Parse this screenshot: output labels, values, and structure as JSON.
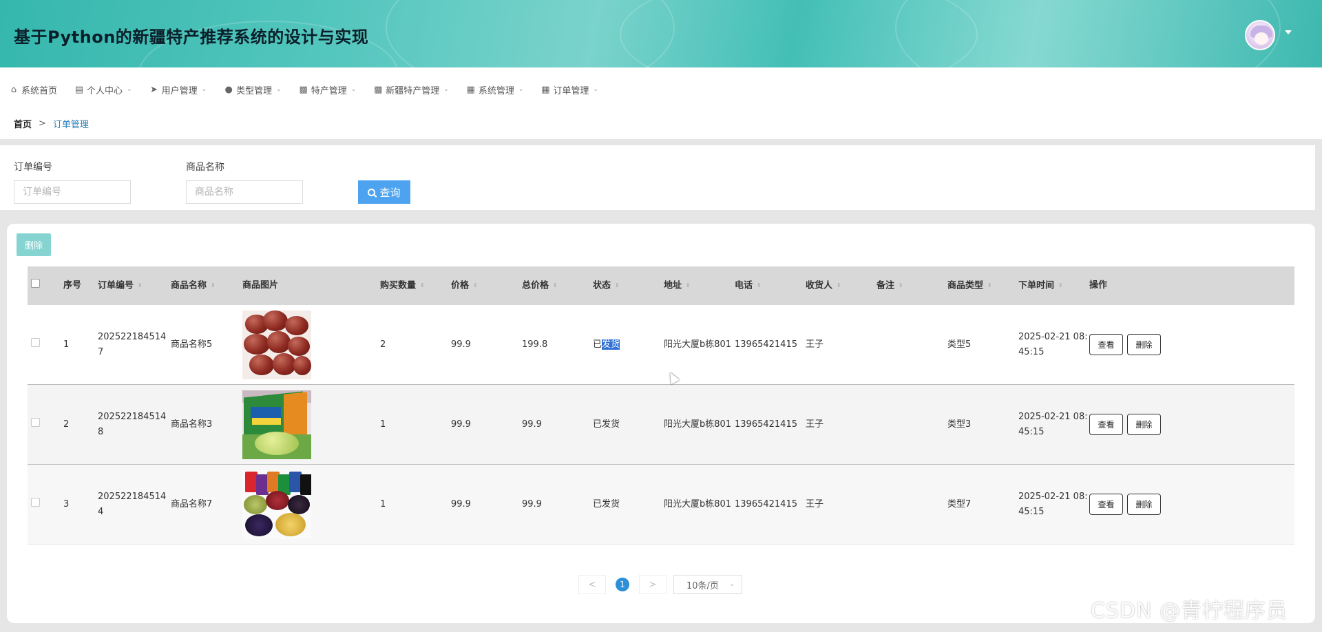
{
  "header": {
    "title": "基于Python的新疆特产推荐系统的设计与实现"
  },
  "nav": {
    "items": [
      {
        "label": "系统首页",
        "icon": "home-icon",
        "has_dropdown": false
      },
      {
        "label": "个人中心",
        "icon": "profile-card-icon",
        "has_dropdown": true
      },
      {
        "label": "用户管理",
        "icon": "paper-plane-icon",
        "has_dropdown": true
      },
      {
        "label": "类型管理",
        "icon": "bulb-icon",
        "has_dropdown": true
      },
      {
        "label": "特产管理",
        "icon": "shop-icon",
        "has_dropdown": true
      },
      {
        "label": "新疆特产管理",
        "icon": "chat-icon",
        "has_dropdown": true
      },
      {
        "label": "系统管理",
        "icon": "grid-icon",
        "has_dropdown": true
      },
      {
        "label": "订单管理",
        "icon": "grid-icon",
        "has_dropdown": true
      }
    ]
  },
  "breadcrumb": {
    "home": "首页",
    "separator": ">",
    "current": "订单管理"
  },
  "search": {
    "order_no_label": "订单编号",
    "order_no_placeholder": "订单编号",
    "product_label": "商品名称",
    "product_placeholder": "商品名称",
    "query_label": "查询"
  },
  "toolbar": {
    "delete_label": "删除"
  },
  "table": {
    "headers": [
      "序号",
      "订单编号",
      "商品名称",
      "商品图片",
      "购买数量",
      "价格",
      "总价格",
      "状态",
      "地址",
      "电话",
      "收货人",
      "备注",
      "商品类型",
      "下单时间",
      "操作"
    ],
    "rows": [
      {
        "index": "1",
        "order_no": "2025221845147",
        "product": "商品名称5",
        "image": "red-dates",
        "qty": "2",
        "price": "99.9",
        "total": "199.8",
        "status_pre": "已",
        "status_hl": "发货",
        "address": "阳光大厦b栋801",
        "phone": "13965421415",
        "receiver": "王子",
        "remark": "",
        "type": "类型5",
        "time": "2025-02-21 08:45:15",
        "view": "查看",
        "delete": "删除"
      },
      {
        "index": "2",
        "order_no": "2025221845148",
        "product": "商品名称3",
        "image": "gift-box",
        "qty": "1",
        "price": "99.9",
        "total": "99.9",
        "status_pre": "已发货",
        "status_hl": "",
        "address": "阳光大厦b栋801",
        "phone": "13965421415",
        "receiver": "王子",
        "remark": "",
        "type": "类型3",
        "time": "2025-02-21 08:45:15",
        "view": "查看",
        "delete": "删除"
      },
      {
        "index": "3",
        "order_no": "2025221845144",
        "product": "商品名称7",
        "image": "dried-fruit-mix",
        "qty": "1",
        "price": "99.9",
        "total": "99.9",
        "status_pre": "已发货",
        "status_hl": "",
        "address": "阳光大厦b栋801",
        "phone": "13965421415",
        "receiver": "王子",
        "remark": "",
        "type": "类型7",
        "time": "2025-02-21 08:45:15",
        "view": "查看",
        "delete": "删除"
      }
    ]
  },
  "pagination": {
    "prev": "<",
    "current": "1",
    "next": ">",
    "page_size": "10条/页"
  },
  "watermark": "CSDN @青柠程序员"
}
